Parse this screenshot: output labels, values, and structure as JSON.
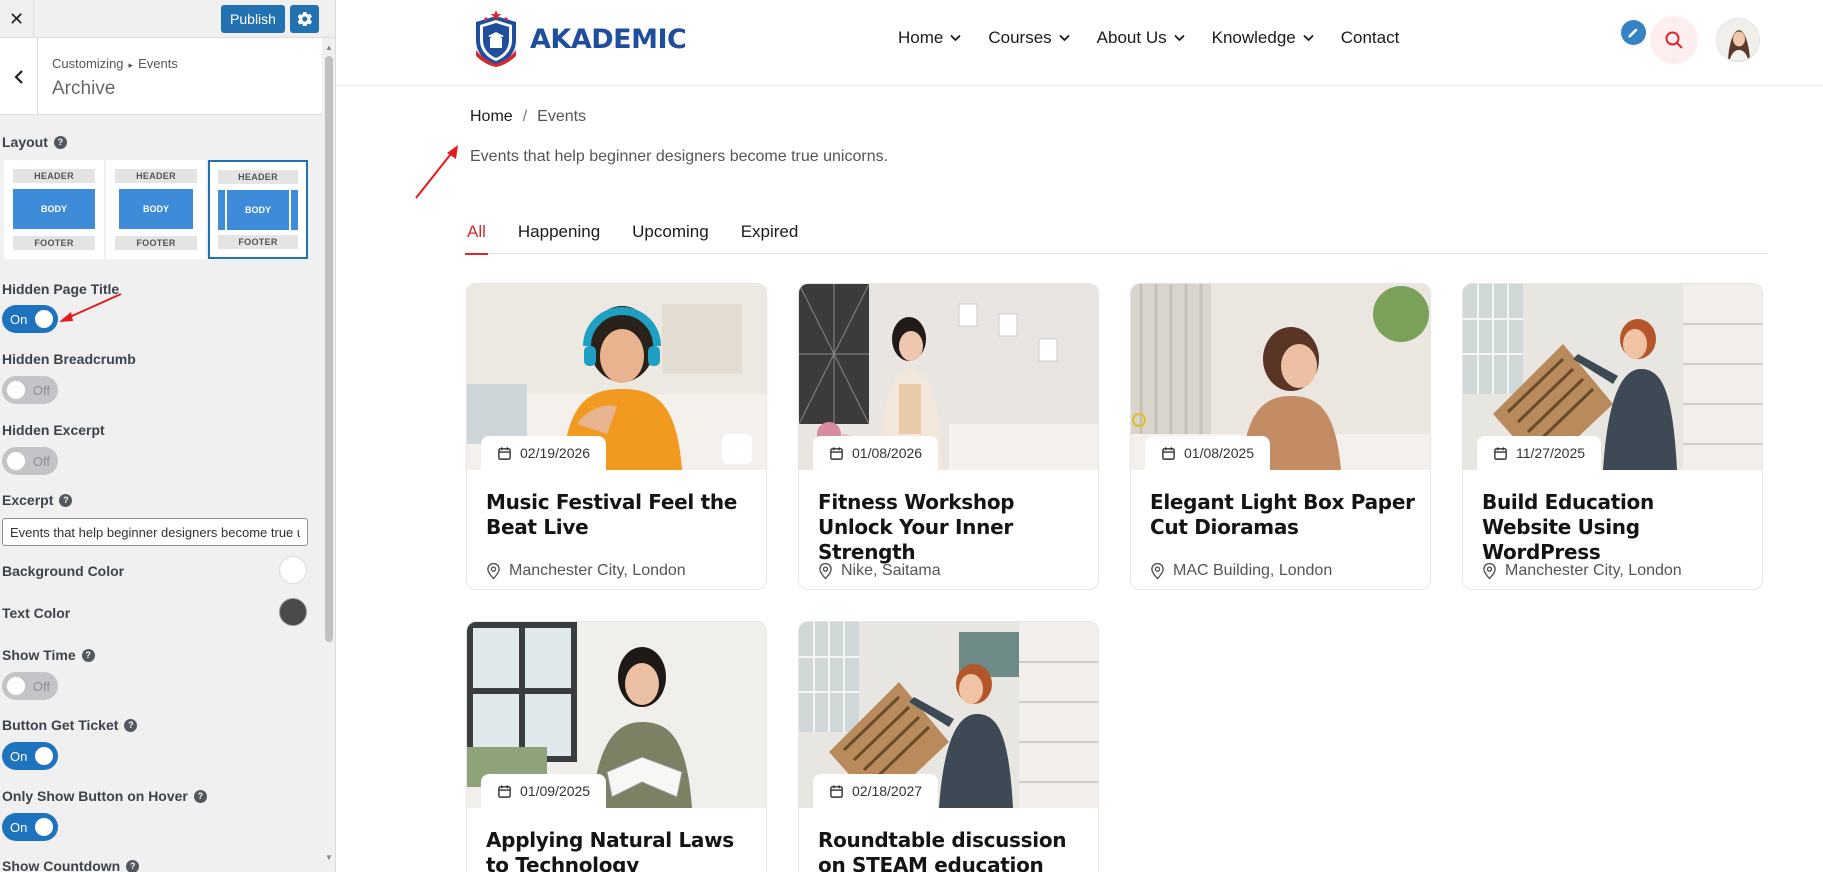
{
  "customizer": {
    "close_icon": "close-icon",
    "publish_label": "Publish",
    "gear_icon": "gear-icon",
    "breadcrumb": {
      "root": "Customizing",
      "section": "Events"
    },
    "section_title": "Archive",
    "controls": {
      "layout_label": "Layout",
      "layout_options": [
        {
          "header": "HEADER",
          "body": "BODY",
          "footer": "FOOTER",
          "variant": "full"
        },
        {
          "header": "HEADER",
          "body": "BODY",
          "footer": "FOOTER",
          "variant": "boxed"
        },
        {
          "header": "HEADER",
          "body": "BODY",
          "footer": "FOOTER",
          "variant": "sidebars",
          "selected": true
        }
      ],
      "hidden_page_title": {
        "label": "Hidden Page Title",
        "state": "On"
      },
      "hidden_breadcrumb": {
        "label": "Hidden Breadcrumb",
        "state": "Off"
      },
      "hidden_excerpt": {
        "label": "Hidden Excerpt",
        "state": "Off"
      },
      "excerpt": {
        "label": "Excerpt",
        "value": "Events that help beginner designers become true unicorns."
      },
      "background_color": {
        "label": "Background Color",
        "value": "#ffffff"
      },
      "text_color": {
        "label": "Text Color",
        "value": "#4a4a4a"
      },
      "show_time": {
        "label": "Show Time",
        "state": "Off"
      },
      "button_get_ticket": {
        "label": "Button Get Ticket",
        "state": "On"
      },
      "only_show_button_on_hover": {
        "label": "Only Show Button on Hover",
        "state": "On"
      },
      "show_countdown": {
        "label": "Show Countdown"
      }
    }
  },
  "site": {
    "logo_text": "AKADEMIC",
    "nav": [
      {
        "label": "Home",
        "has_dropdown": true
      },
      {
        "label": "Courses",
        "has_dropdown": true
      },
      {
        "label": "About Us",
        "has_dropdown": true
      },
      {
        "label": "Knowledge",
        "has_dropdown": true
      },
      {
        "label": "Contact",
        "has_dropdown": false
      }
    ],
    "breadcrumb": {
      "home": "Home",
      "separator": "/",
      "current": "Events"
    },
    "excerpt": "Events that help beginner designers become true unicorns.",
    "tabs": [
      {
        "label": "All",
        "active": true
      },
      {
        "label": "Happening"
      },
      {
        "label": "Upcoming"
      },
      {
        "label": "Expired"
      }
    ],
    "events": [
      {
        "date": "02/19/2026",
        "title": "Music Festival Feel the Beat Live",
        "location": "Manchester City, London"
      },
      {
        "date": "01/08/2026",
        "title": "Fitness Workshop Unlock Your Inner Strength",
        "location": "Nike, Saitama"
      },
      {
        "date": "01/08/2025",
        "title": "Elegant Light Box Paper Cut Dioramas",
        "location": "MAC Building, London"
      },
      {
        "date": "11/27/2025",
        "title": "Build Education Website Using WordPress",
        "location": "Manchester City, London"
      },
      {
        "date": "01/09/2025",
        "title": "Applying Natural Laws to Technology",
        "location": ""
      },
      {
        "date": "02/18/2027",
        "title": "Roundtable discussion on STEAM education",
        "location": ""
      }
    ]
  },
  "colors": {
    "accent": "#2271b1",
    "brand": "#1f4f9c",
    "active_tab": "#d6282d",
    "toggle_on": "#1e73be",
    "annotation_arrow": "#e3191c"
  }
}
